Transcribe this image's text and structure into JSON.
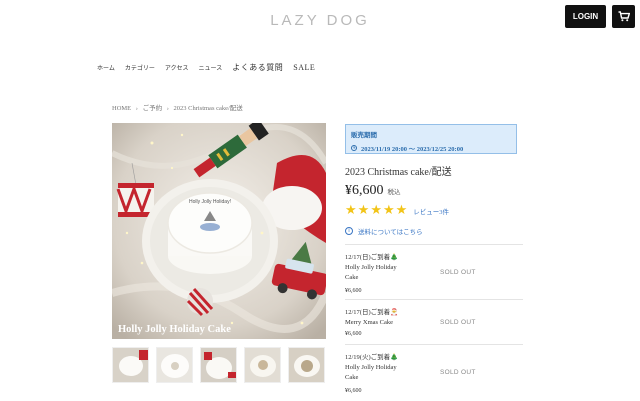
{
  "header": {
    "logo": "LAZY DOG",
    "login_label": "LOGIN"
  },
  "nav": {
    "items": [
      "ホーム",
      "カテゴリー",
      "アクセス",
      "ニュース",
      "よくある質問",
      "SALE"
    ]
  },
  "breadcrumb": [
    "HOME",
    "›",
    "ご予約",
    "›",
    "2023 Christmas cake/配送"
  ],
  "product": {
    "image_caption": "Holly Jolly Holiday Cake",
    "cake_text": "Holly Jolly Holiday!",
    "sale_title": "販売期間",
    "sale_period": "2023/11/19 20:00 〜 2023/12/25 20:00",
    "title": "2023 Christmas cake/配送",
    "price": "¥6,600",
    "tax_label": "税込",
    "rating_stars": 5,
    "review_link": "レビュー3件",
    "shipping_link": "送料についてはこちら"
  },
  "variants": [
    {
      "date": "12/17(日)ご到着🎄",
      "name": "Holly Jolly Holiday Cake",
      "price": "¥6,600",
      "status": "SOLD OUT"
    },
    {
      "date": "12/17(日)ご到着🎅",
      "name": "Merry Xmas Cake",
      "price": "¥6,600",
      "status": "SOLD OUT"
    },
    {
      "date": "12/19(火)ご到着🎄",
      "name": "Holly Jolly Holiday Cake",
      "price": "¥6,600",
      "status": "SOLD OUT"
    }
  ],
  "colors": {
    "accent_blue": "#3a76c4",
    "sale_box_bg": "#dcecfb",
    "star": "#f2c418",
    "header_button": "#111111"
  }
}
